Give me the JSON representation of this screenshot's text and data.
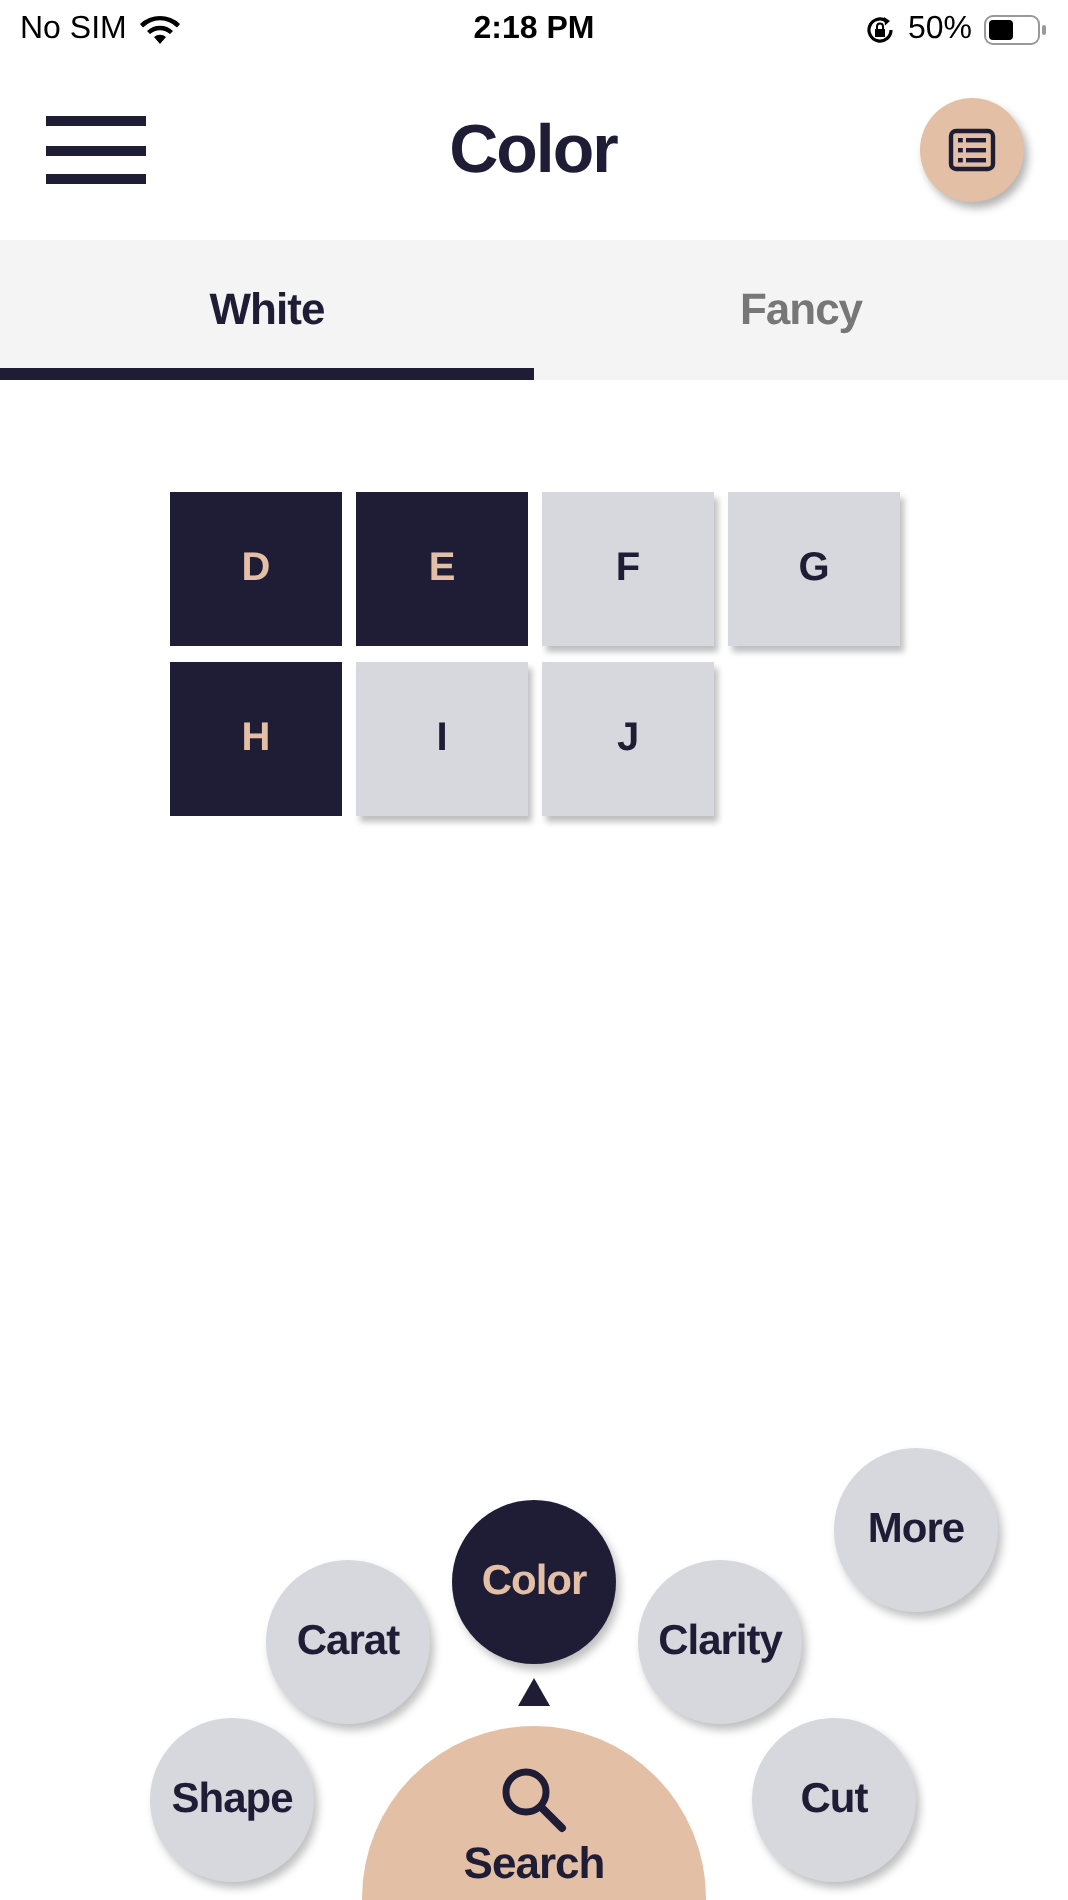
{
  "status_bar": {
    "carrier": "No SIM",
    "time": "2:18 PM",
    "battery": "50%"
  },
  "header": {
    "title": "Color"
  },
  "tabs": [
    {
      "label": "White",
      "selected": true
    },
    {
      "label": "Fancy",
      "selected": false
    }
  ],
  "grades": [
    {
      "label": "D",
      "selected": true
    },
    {
      "label": "E",
      "selected": true
    },
    {
      "label": "F",
      "selected": false
    },
    {
      "label": "G",
      "selected": false
    },
    {
      "label": "H",
      "selected": true
    },
    {
      "label": "I",
      "selected": false
    },
    {
      "label": "J",
      "selected": false
    }
  ],
  "menu": [
    {
      "label": "Shape",
      "selected": false
    },
    {
      "label": "Carat",
      "selected": false
    },
    {
      "label": "Color",
      "selected": true
    },
    {
      "label": "Clarity",
      "selected": false
    },
    {
      "label": "Cut",
      "selected": false
    },
    {
      "label": "More",
      "selected": false
    }
  ],
  "search_button": {
    "label": "Search"
  }
}
